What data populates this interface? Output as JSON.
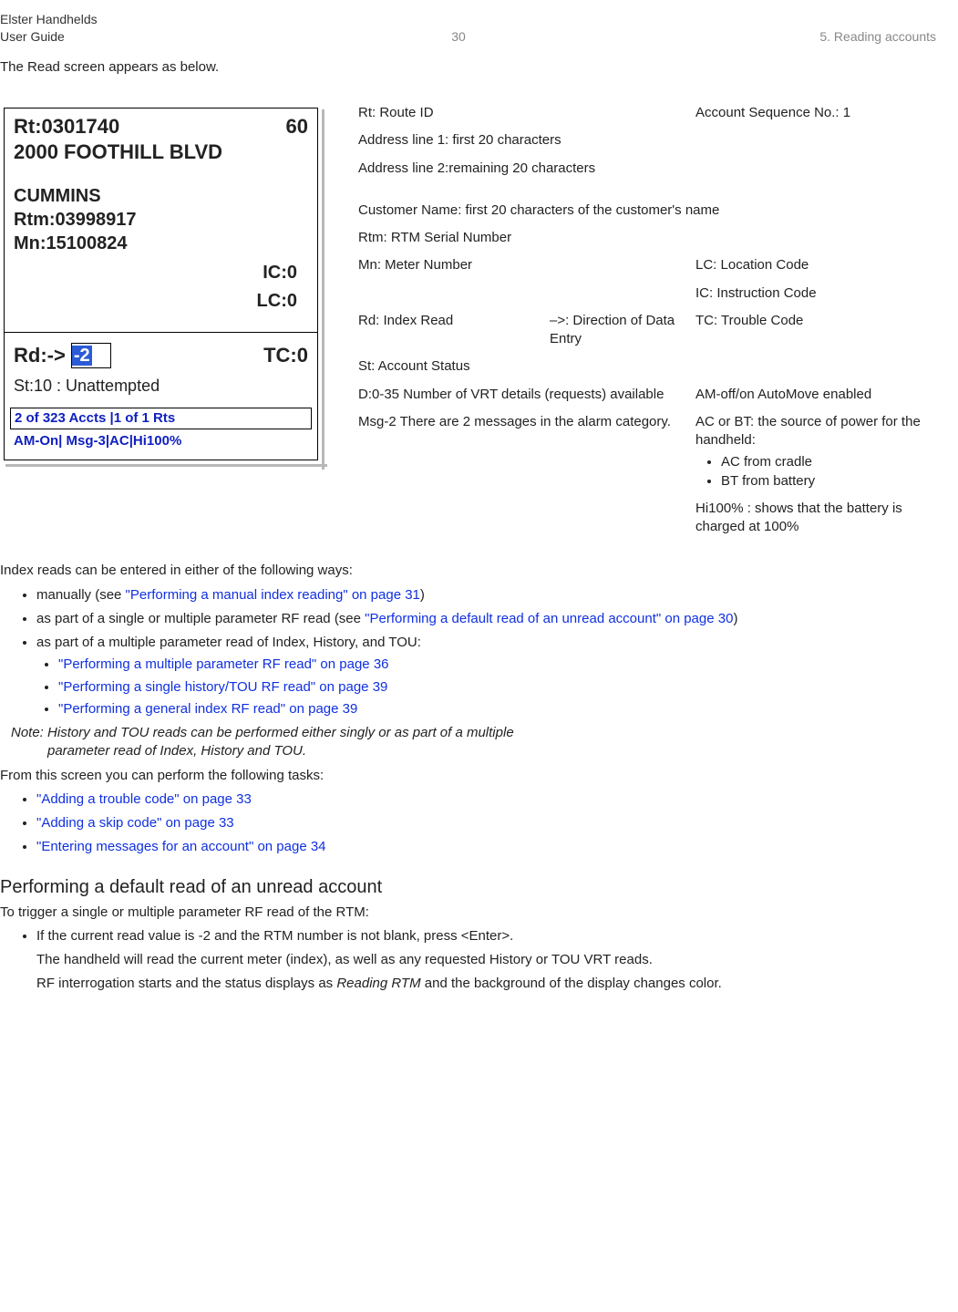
{
  "header": {
    "left_line1": "Elster Handhelds",
    "left_line2": "User Guide",
    "page_number": "30",
    "chapter": "5. Reading accounts"
  },
  "intro": "The Read screen appears as below.",
  "screenshot": {
    "route_label": "Rt:0301740",
    "route_seq": "60",
    "address1": "2000 FOOTHILL BLVD",
    "customer": "CUMMINS",
    "rtm": "Rtm:03998917",
    "mn": "Mn:15100824",
    "ic": "IC:0",
    "lc": "LC:0",
    "rd_prefix": "Rd:->",
    "rd_value_sel": "-2",
    "tc": "TC:0",
    "status": "St:10 : Unattempted",
    "footer1": "2 of 323 Accts |1 of 1 Rts",
    "footer2": "AM-On| Msg-3|AC|Hi100%"
  },
  "legend": {
    "rt": "Rt: Route ID",
    "acct_seq": "Account Sequence No.: 1",
    "addr1": "Address line 1: first 20 characters",
    "addr2": "Address line 2:remaining 20 characters",
    "cust": "Customer Name: first 20 characters of the customer's name",
    "rtm": "Rtm: RTM Serial Number",
    "mn": "Mn: Meter Number",
    "lc": "LC: Location Code",
    "ic": "IC: Instruction Code",
    "rd": "Rd: Index Read",
    "dir": "–>: Direction of Data Entry",
    "tc": "TC: Trouble Code",
    "st": "St: Account Status",
    "d": "D:0-35 Number of VRT details (requests) available",
    "am": "AM-off/on AutoMove enabled",
    "msg": "Msg-2 There are 2 messages in the alarm category.",
    "power_intro": "AC or BT: the source of power for the handheld:",
    "power_ac": "AC from cradle",
    "power_bt": "BT from battery",
    "hi": "Hi100% : shows that the battery is charged at 100%"
  },
  "body": {
    "index_intro": "Index reads can be entered in either of the following ways:",
    "li_manual_pre": "manually (see ",
    "li_manual_link": "\"Performing a manual index reading\" on page 31",
    "li_manual_post": ")",
    "li_rf_pre": "as part of a single or multiple parameter RF read (see ",
    "li_rf_link": "\"Performing a default read of an unread account\" on page 30",
    "li_rf_post": ")",
    "li_multi": "as part of a multiple parameter read of Index, History, and TOU:",
    "sub1": "\"Performing a multiple parameter RF read\" on page 36",
    "sub2": "\"Performing a single history/TOU RF read\" on page 39",
    "sub3": "\"Performing a general index RF read\" on page 39",
    "note_label": "Note: ",
    "note_text1": "History and TOU reads can be performed either singly or as part of a multiple",
    "note_text2": "parameter read of Index, History and TOU.",
    "tasks_intro": "From this screen you can perform the following tasks:",
    "task1": "\"Adding a trouble code\" on page 33",
    "task2": "\"Adding a skip code\" on page 33",
    "task3": "\"Entering messages for an account\" on page 34",
    "sec_title": "Performing a default read of an unread account",
    "sec_lead": "To trigger a single or multiple parameter RF read of the RTM:",
    "step1": "If the current read value is -2 and the RTM number is not blank, press <Enter>.",
    "step1_p1": "The handheld will read the current meter (index), as well as any requested History or TOU VRT reads.",
    "step1_p2a": "RF interrogation starts and the status displays as ",
    "step1_p2_em": "Reading RTM",
    "step1_p2b": " and the background of the display changes color."
  }
}
